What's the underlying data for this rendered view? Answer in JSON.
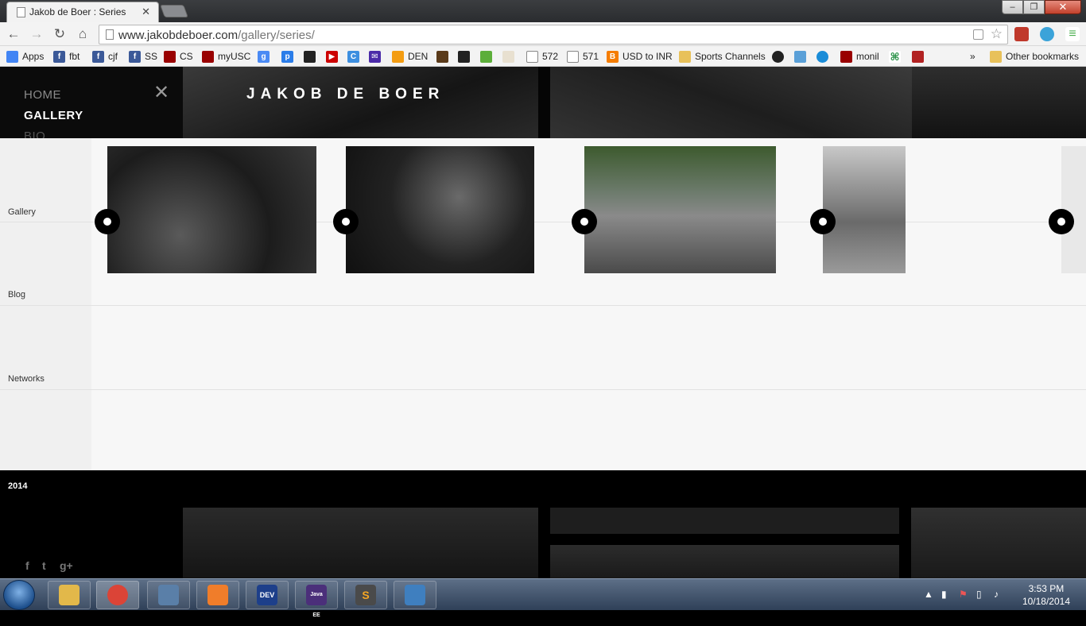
{
  "browser": {
    "tab_title": "Jakob de Boer : Series",
    "url_domain": "www.jakobdeboer.com",
    "url_path": "/gallery/series/",
    "window_close": "✕",
    "window_min": "–",
    "window_max": "❐"
  },
  "bookmarks": {
    "items": [
      {
        "label": "Apps",
        "icon": "apps-icon",
        "color": "#4285f4"
      },
      {
        "label": "fbt",
        "icon": "facebook-icon",
        "color": "#3b5998"
      },
      {
        "label": "cjf",
        "icon": "facebook-icon",
        "color": "#3b5998"
      },
      {
        "label": "SS",
        "icon": "facebook-icon",
        "color": "#3b5998"
      },
      {
        "label": "CS",
        "icon": "usc-icon",
        "color": "#990000"
      },
      {
        "label": "myUSC",
        "icon": "usc-icon",
        "color": "#990000"
      },
      {
        "label": "572",
        "icon": "page-icon",
        "color": "#ffffff"
      },
      {
        "label": "571",
        "icon": "page-icon",
        "color": "#ffffff"
      },
      {
        "label": "USD to INR",
        "icon": "blogger-icon",
        "color": "#f57d00"
      },
      {
        "label": "Sports Channels",
        "icon": "folder-icon",
        "color": "#e8c15a"
      },
      {
        "label": "monil",
        "icon": "usc-icon",
        "color": "#990000"
      },
      {
        "label": "DEN",
        "icon": "den-icon",
        "color": "#f39c12"
      }
    ],
    "overflow": "»",
    "other": "Other bookmarks"
  },
  "site": {
    "title": "JAKOB DE BOER",
    "menu": [
      "HOME",
      "GALLERY",
      "BIO"
    ],
    "menu_close": "✕",
    "sections": [
      "Gallery",
      "Blog",
      "Networks"
    ],
    "year": "2014",
    "social": [
      "f",
      "t",
      "g+"
    ]
  },
  "taskbar": {
    "time": "3:53 PM",
    "date": "10/18/2014",
    "apps": [
      {
        "name": "explorer",
        "label": "",
        "color": "#e2b84a"
      },
      {
        "name": "chrome",
        "label": "",
        "color": "#db4437"
      },
      {
        "name": "notepad",
        "label": "",
        "color": "#5a7fa8"
      },
      {
        "name": "xampp",
        "label": "",
        "color": "#f07d2a"
      },
      {
        "name": "devcpp",
        "label": "DEV",
        "color": "#1d3f8a"
      },
      {
        "name": "javaee-ide",
        "label": "Java EE",
        "color": "#4b2f7a"
      },
      {
        "name": "sublime",
        "label": "S",
        "color": "#4a4a4a"
      },
      {
        "name": "paint",
        "label": "",
        "color": "#3f7fbf"
      }
    ]
  }
}
